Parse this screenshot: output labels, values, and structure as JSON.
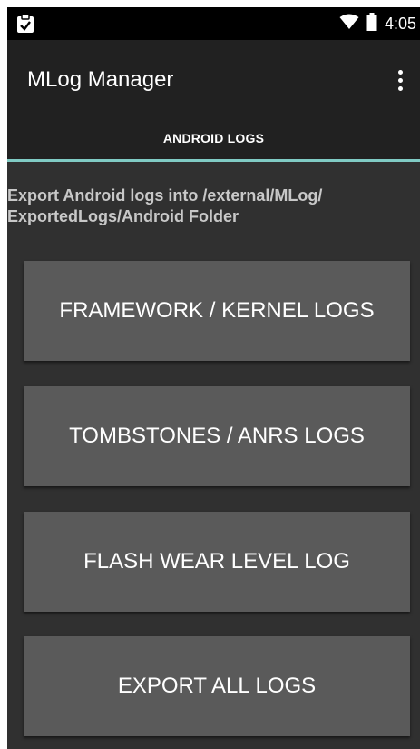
{
  "status_bar": {
    "time": "4:05",
    "icons": [
      "clipboard-check-icon",
      "wifi-icon",
      "battery-icon"
    ],
    "color": "#000000"
  },
  "app_bar": {
    "title": "MLog Manager",
    "menu_icon": "overflow-menu-icon",
    "color": "#212121"
  },
  "tabs": [
    {
      "label": "ANDROID LOGS",
      "selected": true
    }
  ],
  "accent": "#80cbc4",
  "description": "Export Android logs into /external/MLog/ ExportedLogs/Android Folder",
  "buttons": [
    {
      "label": "FRAMEWORK / KERNEL LOGS"
    },
    {
      "label": "TOMBSTONES / ANRS LOGS"
    },
    {
      "label": "FLASH WEAR LEVEL LOG"
    },
    {
      "label": "EXPORT ALL LOGS"
    }
  ],
  "button_color": "#5a5a5a",
  "background": "#303030"
}
